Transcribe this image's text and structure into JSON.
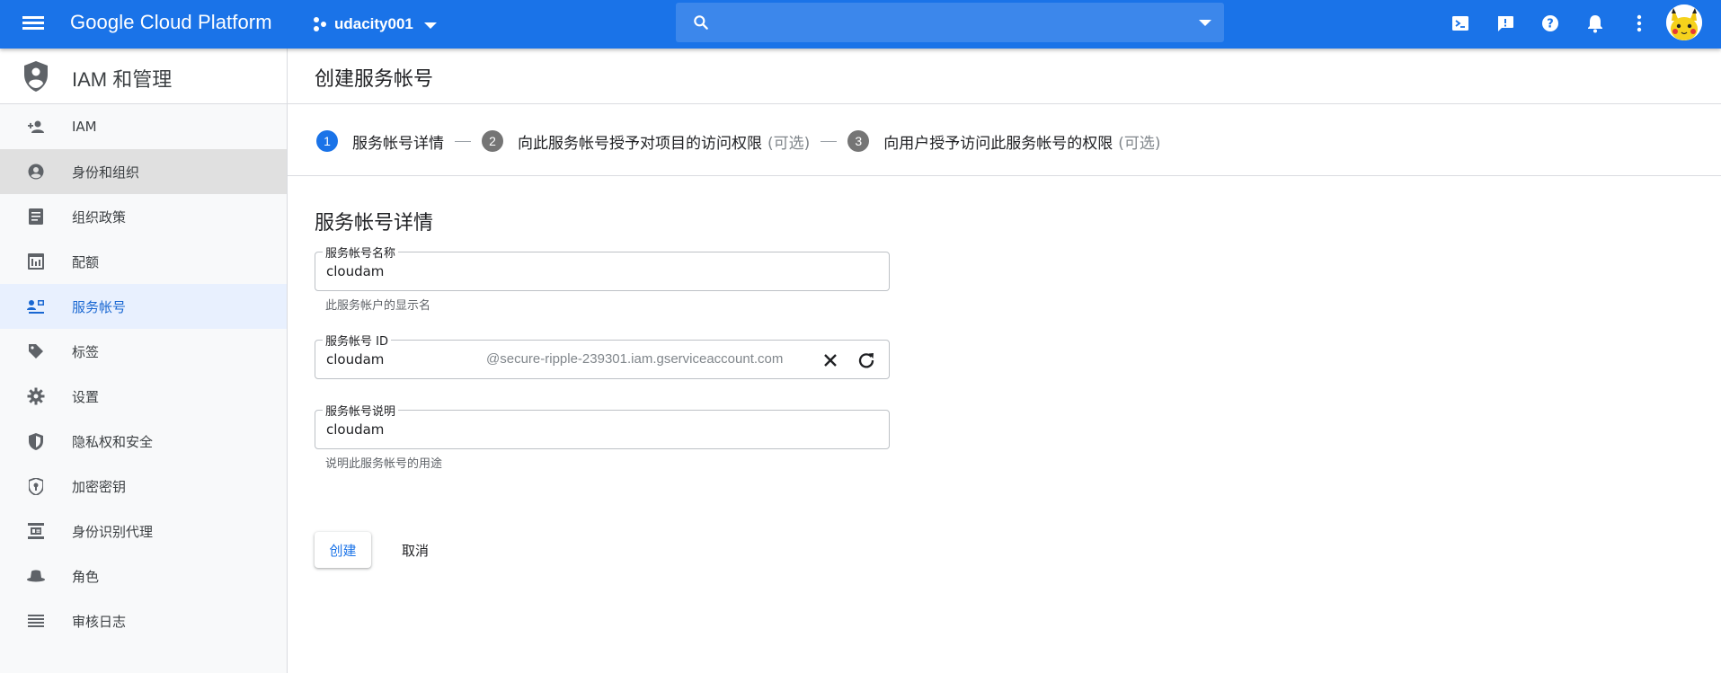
{
  "topbar": {
    "brand": "Google Cloud Platform",
    "project": "udacity001",
    "search_placeholder": "",
    "icons": [
      "menu-icon",
      "project-icon",
      "search-icon",
      "cloud-shell-icon",
      "feedback-icon",
      "help-icon",
      "notifications-icon",
      "more-vert-icon",
      "account-avatar"
    ]
  },
  "sidebar": {
    "title": "IAM 和管理",
    "items": [
      {
        "label": "IAM",
        "icon": "person-add-icon"
      },
      {
        "label": "身份和组织",
        "icon": "account-circle-icon",
        "state": "hover"
      },
      {
        "label": "组织政策",
        "icon": "policy-doc-icon"
      },
      {
        "label": "配额",
        "icon": "quota-icon"
      },
      {
        "label": "服务帐号",
        "icon": "service-account-icon",
        "state": "active"
      },
      {
        "label": "标签",
        "icon": "label-tag-icon"
      },
      {
        "label": "设置",
        "icon": "settings-gear-icon"
      },
      {
        "label": "隐私权和安全",
        "icon": "privacy-shield-icon"
      },
      {
        "label": "加密密钥",
        "icon": "encryption-key-icon"
      },
      {
        "label": "身份识别代理",
        "icon": "identity-proxy-icon"
      },
      {
        "label": "角色",
        "icon": "roles-hat-icon"
      },
      {
        "label": "审核日志",
        "icon": "audit-logs-icon"
      }
    ]
  },
  "main": {
    "page_title": "创建服务帐号",
    "steps": [
      {
        "num": "1",
        "label": "服务帐号详情",
        "optional": ""
      },
      {
        "num": "2",
        "label": "向此服务帐号授予对项目的访问权限",
        "optional": "(可选)"
      },
      {
        "num": "3",
        "label": "向用户授予访问此服务帐号的权限",
        "optional": "(可选)"
      }
    ],
    "section_title": "服务帐号详情",
    "fields": {
      "name": {
        "label": "服务帐号名称",
        "value": "cloudam",
        "hint": "此服务帐户的显示名"
      },
      "id": {
        "label": "服务帐号 ID",
        "value": "cloudam",
        "suffix": "@secure-ripple-239301.iam.gserviceaccount.com"
      },
      "description": {
        "label": "服务帐号说明",
        "value": "cloudam",
        "hint": "说明此服务帐号的用途"
      }
    },
    "buttons": {
      "create": "创建",
      "cancel": "取消"
    }
  },
  "colors": {
    "topbar": "#1a73e8",
    "accent": "#1a73e8",
    "active_nav_bg": "#e8f0fe",
    "hover_nav_bg": "#e0e0e0"
  }
}
